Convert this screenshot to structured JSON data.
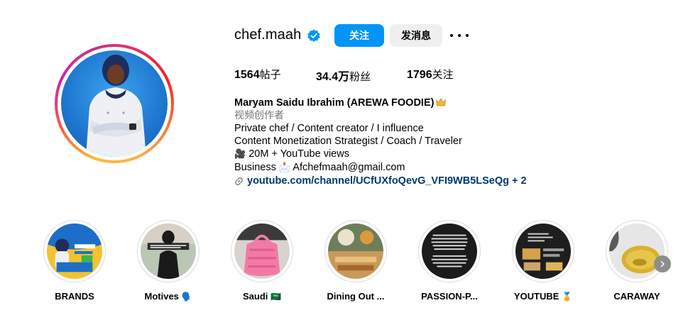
{
  "profile": {
    "username": "chef.maah",
    "follow_label": "关注",
    "message_label": "发消息",
    "stats": {
      "posts_value": "1564",
      "posts_label": "帖子",
      "followers_value": "34.4万",
      "followers_label": "粉丝",
      "following_value": "1796",
      "following_label": "关注"
    },
    "bio": {
      "name": "Maryam Saidu Ibrahim (AREWA FOODIE)",
      "category": "视频创作者",
      "line1": "Private chef / Content creator / I influence",
      "line2": "Content Monetization Strategist / Coach / Traveler",
      "line3_emoji": "🎥",
      "line3": "20M + YouTube views",
      "line4_prefix": "Business",
      "line4_emoji": "📩",
      "line4_email": "Afchefmaah@gmail.com",
      "link": "youtube.com/channel/UCfUXfoQevG_VFI9WB5LSeQg + 2"
    }
  },
  "highlights": [
    {
      "label": "BRANDS",
      "emoji": ""
    },
    {
      "label": "Motives",
      "emoji": "🗣️"
    },
    {
      "label": "Saudi",
      "emoji": "🇸🇦"
    },
    {
      "label": "Dining Out ...",
      "emoji": ""
    },
    {
      "label": "PASSION-P...",
      "emoji": ""
    },
    {
      "label": "YOUTUBE",
      "emoji": "🏅"
    },
    {
      "label": "CARAWAY",
      "emoji": ""
    }
  ],
  "colors": {
    "accent": "#0095f6",
    "link": "#00376b",
    "secondary_button": "#efefef",
    "muted_text": "#737373"
  },
  "icons": [
    "verified-badge-icon",
    "more-options-icon",
    "link-icon",
    "crown-icon",
    "chevron-right-icon"
  ]
}
